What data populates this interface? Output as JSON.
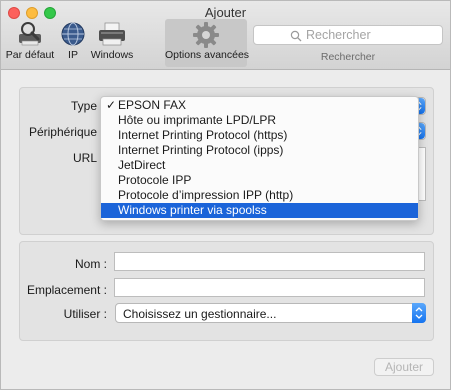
{
  "window": {
    "title": "Ajouter"
  },
  "toolbar": {
    "items": [
      {
        "label": "Par défaut",
        "icon": "default-printer-icon"
      },
      {
        "label": "IP",
        "icon": "ip-globe-icon"
      },
      {
        "label": "Windows",
        "icon": "windows-printer-icon"
      },
      {
        "label": "Options avancées",
        "icon": "gear-icon",
        "active": true
      }
    ],
    "search": {
      "placeholder": "Rechercher",
      "label": "Rechercher"
    }
  },
  "form": {
    "type_label": "Type",
    "device_label": "Périphérique",
    "url_label": "URL",
    "name_label": "Nom :",
    "location_label": "Emplacement :",
    "use_label": "Utiliser :",
    "use_value": "Choisissez un gestionnaire...",
    "name_value": "",
    "location_value": ""
  },
  "type_menu": {
    "checked_item": "EPSON FAX",
    "highlighted_item": "Windows printer via spoolss",
    "items": [
      "EPSON FAX",
      "Hôte ou imprimante LPD/LPR",
      "Internet Printing Protocol (https)",
      "Internet Printing Protocol (ipps)",
      "JetDirect",
      "Protocole IPP",
      "Protocole d’impression IPP (http)",
      "Windows printer via spoolss"
    ]
  },
  "buttons": {
    "add": "Ajouter"
  },
  "colors": {
    "accent": "#1b64d9",
    "stepper": "#1574f0"
  }
}
